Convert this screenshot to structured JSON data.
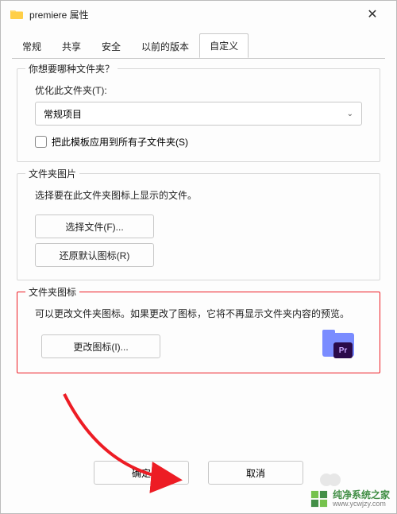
{
  "window": {
    "title": "premiere 属性"
  },
  "tabs": {
    "items": [
      {
        "label": "常规"
      },
      {
        "label": "共享"
      },
      {
        "label": "安全"
      },
      {
        "label": "以前的版本"
      },
      {
        "label": "自定义",
        "active": true
      }
    ]
  },
  "folderType": {
    "legend": "你想要哪种文件夹？",
    "optimizeLabel": "优化此文件夹(T):",
    "selectValue": "常规项目",
    "applyToSubfolders": "把此模板应用到所有子文件夹(S)"
  },
  "folderPicture": {
    "legend": "文件夹图片",
    "desc": "选择要在此文件夹图标上显示的文件。",
    "chooseFile": "选择文件(F)...",
    "restoreDefault": "还原默认图标(R)"
  },
  "folderIcon": {
    "legend": "文件夹图标",
    "desc": "可以更改文件夹图标。如果更改了图标，它将不再显示文件夹内容的预览。",
    "changeIcon": "更改图标(I)...",
    "iconLabel": "Pr"
  },
  "footer": {
    "ok": "确定",
    "cancel": "取消"
  },
  "watermark": {
    "name": "纯净系统之家",
    "url": "www.ycwjzy.com"
  }
}
